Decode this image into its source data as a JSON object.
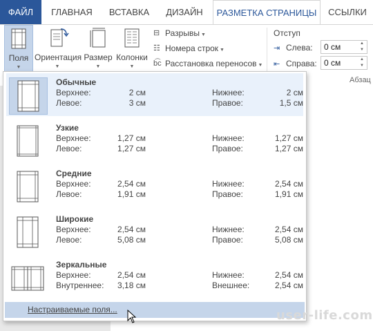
{
  "tabs": {
    "file": "ФАЙЛ",
    "home": "ГЛАВНАЯ",
    "insert": "ВСТАВКА",
    "design": "ДИЗАЙН",
    "layout": "РАЗМЕТКА СТРАНИЦЫ",
    "references": "ССЫЛКИ"
  },
  "ribbon": {
    "margins": "Поля",
    "orientation": "Ориентация",
    "size": "Размер",
    "columns": "Колонки",
    "breaks": "Разрывы",
    "line_numbers": "Номера строк",
    "hyphenation": "Расстановка переносов",
    "indent_title": "Отступ",
    "left_label": "Слева:",
    "left_value": "0 см",
    "right_label": "Справа:",
    "right_value": "0 см",
    "group_label": "Абзац"
  },
  "margins_menu": {
    "presets": [
      {
        "name": "Обычные",
        "top_label": "Верхнее:",
        "top": "2 см",
        "bottom_label": "Нижнее:",
        "bottom": "2 см",
        "left_label": "Левое:",
        "left": "3 см",
        "right_label": "Правое:",
        "right": "1,5 см"
      },
      {
        "name": "Узкие",
        "top_label": "Верхнее:",
        "top": "1,27 см",
        "bottom_label": "Нижнее:",
        "bottom": "1,27 см",
        "left_label": "Левое:",
        "left": "1,27 см",
        "right_label": "Правое:",
        "right": "1,27 см"
      },
      {
        "name": "Средние",
        "top_label": "Верхнее:",
        "top": "2,54 см",
        "bottom_label": "Нижнее:",
        "bottom": "2,54 см",
        "left_label": "Левое:",
        "left": "1,91 см",
        "right_label": "Правое:",
        "right": "1,91 см"
      },
      {
        "name": "Широкие",
        "top_label": "Верхнее:",
        "top": "2,54 см",
        "bottom_label": "Нижнее:",
        "bottom": "2,54 см",
        "left_label": "Левое:",
        "left": "5,08 см",
        "right_label": "Правое:",
        "right": "5,08 см"
      },
      {
        "name": "Зеркальные",
        "top_label": "Верхнее:",
        "top": "2,54 см",
        "bottom_label": "Нижнее:",
        "bottom": "2,54 см",
        "left_label": "Внутреннее:",
        "left": "3,18 см",
        "right_label": "Внешнее:",
        "right": "2,54 см"
      }
    ],
    "custom_item": "Настраиваемые поля..."
  },
  "watermark": "user-life.com",
  "colors": {
    "accent": "#2b579a",
    "hover": "#c5d5ea",
    "selected_bg": "#e9f1fb"
  }
}
